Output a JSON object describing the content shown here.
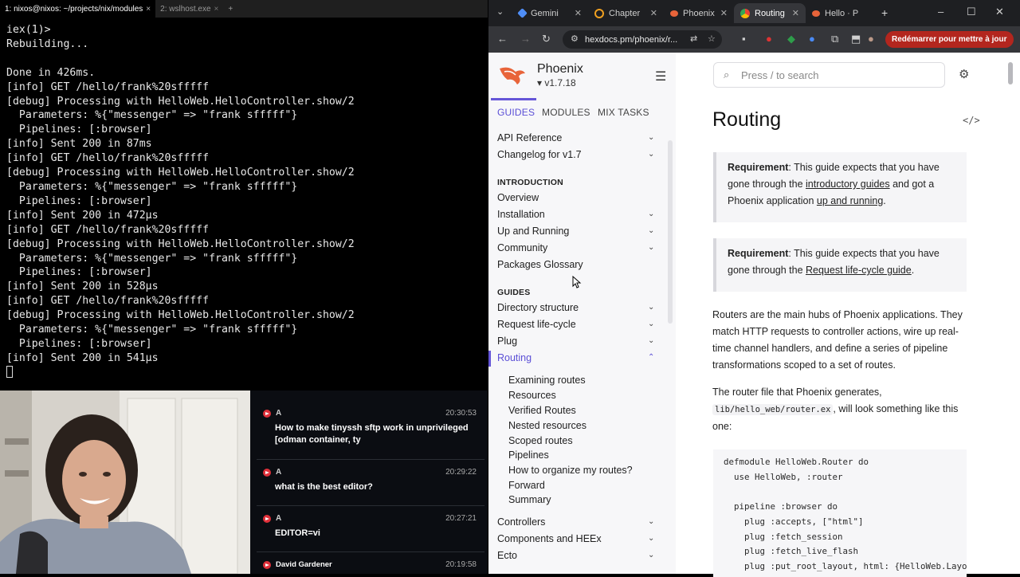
{
  "terminal": {
    "tabs": [
      {
        "label": "1: nixos@nixos: ~/projects/nix/modules",
        "active": true
      },
      {
        "label": "2: wslhost.exe",
        "active": false
      }
    ],
    "lines": [
      "iex(1)>",
      "Rebuilding...",
      "",
      "Done in 426ms.",
      "[info] GET /hello/frank%20sfffff",
      "[debug] Processing with HelloWeb.HelloController.show/2",
      "  Parameters: %{\"messenger\" => \"frank sfffff\"}",
      "  Pipelines: [:browser]",
      "[info] Sent 200 in 87ms",
      "[info] GET /hello/frank%20sfffff",
      "[debug] Processing with HelloWeb.HelloController.show/2",
      "  Parameters: %{\"messenger\" => \"frank sfffff\"}",
      "  Pipelines: [:browser]",
      "[info] Sent 200 in 472µs",
      "[info] GET /hello/frank%20sfffff",
      "[debug] Processing with HelloWeb.HelloController.show/2",
      "  Parameters: %{\"messenger\" => \"frank sfffff\"}",
      "  Pipelines: [:browser]",
      "[info] Sent 200 in 528µs",
      "[info] GET /hello/frank%20sfffff",
      "[debug] Processing with HelloWeb.HelloController.show/2",
      "  Parameters: %{\"messenger\" => \"frank sfffff\"}",
      "  Pipelines: [:browser]",
      "[info] Sent 200 in 541µs"
    ]
  },
  "chat": {
    "messages": [
      {
        "name": "A",
        "time": "20:30:53",
        "text": "How to make tinyssh sftp work in unprivileged [odman container, ty"
      },
      {
        "name": "A",
        "time": "20:29:22",
        "text": "what is the best editor?"
      },
      {
        "name": "A",
        "time": "20:27:21",
        "text": "EDITOR=vi"
      },
      {
        "name": "David Gardener",
        "time": "20:19:58",
        "text": ""
      }
    ]
  },
  "browser": {
    "tabs": [
      {
        "label": "Gemini",
        "active": false,
        "color": "#4f8ef7"
      },
      {
        "label": "Chapter",
        "active": false,
        "color": "#f0a020"
      },
      {
        "label": "Phoenix",
        "active": false,
        "color": "#e8643a"
      },
      {
        "label": "Routing",
        "active": true,
        "color": "#e8643a"
      },
      {
        "label": "Hello · P",
        "active": false,
        "color": "#e8643a"
      }
    ],
    "url": "hexdocs.pm/phoenix/r...",
    "restart_label": "Redémarrer pour mettre à jour",
    "restart_color": "#b3261e"
  },
  "sidebar": {
    "project": "Phoenix",
    "version": "▾ v1.7.18",
    "tabs": [
      "GUIDES",
      "MODULES",
      "MIX TASKS"
    ],
    "top_items": [
      "API Reference",
      "Changelog for v1.7"
    ],
    "section_intro": "INTRODUCTION",
    "intro_items": [
      "Overview",
      "Installation",
      "Up and Running",
      "Community",
      "Packages Glossary"
    ],
    "section_guides": "GUIDES",
    "guide_items": [
      "Directory structure",
      "Request life-cycle",
      "Plug",
      "Routing"
    ],
    "routing_subitems": [
      "Examining routes",
      "Resources",
      "Verified Routes",
      "Nested resources",
      "Scoped routes",
      "Pipelines",
      "How to organize my routes?",
      "Forward",
      "Summary"
    ],
    "after_items": [
      "Controllers",
      "Components and HEEx",
      "Ecto"
    ]
  },
  "content": {
    "search_placeholder": "Press / to search",
    "title": "Routing",
    "callout1": {
      "label": "Requirement",
      "pre": ": This guide expects that you have gone through the ",
      "link1": "introductory guides",
      "mid": " and got a Phoenix application ",
      "link2": "up and running",
      "post": "."
    },
    "callout2": {
      "label": "Requirement",
      "pre": ": This guide expects that you have gone through the ",
      "link1": "Request life-cycle guide",
      "post": "."
    },
    "para1": "Routers are the main hubs of Phoenix applications. They match HTTP requests to controller actions, wire up real-time channel handlers, and define a series of pipeline transformations scoped to a set of routes.",
    "para2_pre": "The router file that Phoenix generates,",
    "para2_code": "lib/hello_web/router.ex",
    "para2_post": ", will look something like this one:",
    "code": [
      "defmodule HelloWeb.Router do",
      "  use HelloWeb, :router",
      "",
      "  pipeline :browser do",
      "    plug :accepts, [\"html\"]",
      "    plug :fetch_session",
      "    plug :fetch_live_flash",
      "    plug :put_root_layout, html: {HelloWeb.Layouts"
    ]
  }
}
